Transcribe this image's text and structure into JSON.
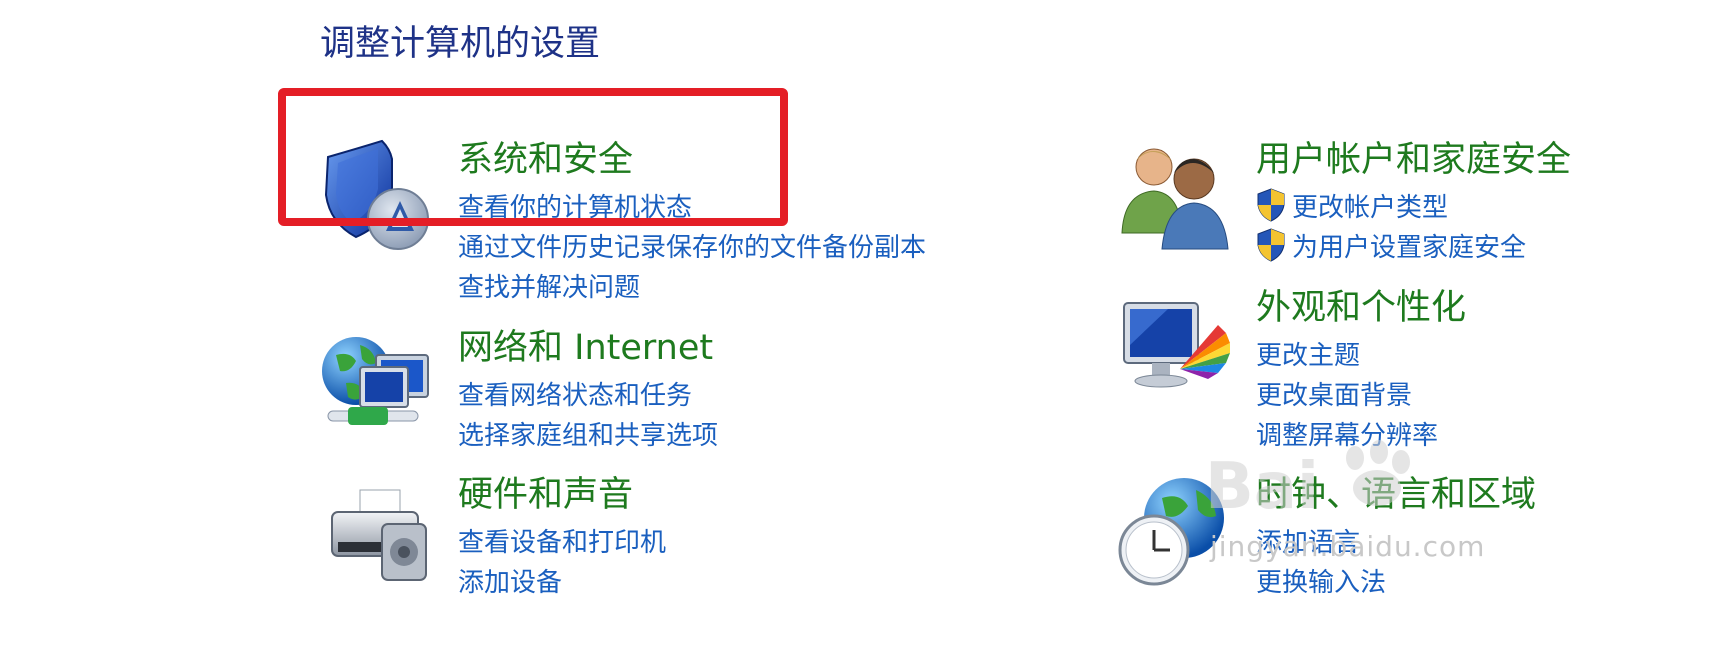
{
  "page_title": "调整计算机的设置",
  "categories": {
    "system": {
      "title": "系统和安全",
      "icon": "shield-icon",
      "links": [
        "查看你的计算机状态",
        "通过文件历史记录保存你的文件备份副本",
        "查找并解决问题"
      ]
    },
    "network": {
      "title": "网络和 Internet",
      "icon": "network-globe-icon",
      "links": [
        "查看网络状态和任务",
        "选择家庭组和共享选项"
      ]
    },
    "hardware": {
      "title": "硬件和声音",
      "icon": "printer-icon",
      "links": [
        "查看设备和打印机",
        "添加设备"
      ]
    },
    "users": {
      "title": "用户帐户和家庭安全",
      "icon": "users-icon",
      "links": [
        "更改帐户类型",
        "为用户设置家庭安全"
      ]
    },
    "appearance": {
      "title": "外观和个性化",
      "icon": "monitor-palette-icon",
      "links": [
        "更改主题",
        "更改桌面背景",
        "调整屏幕分辨率"
      ]
    },
    "clock": {
      "title": "时钟、语言和区域",
      "icon": "clock-globe-icon",
      "links": [
        "添加语言",
        "更换输入法"
      ]
    }
  },
  "watermark": {
    "text": "jingyan.baidu.com",
    "logo_text": "Bai"
  },
  "colors": {
    "title": "#1e3287",
    "category_title": "#1e7a1e",
    "link": "#1a5fbf",
    "highlight": "#e41e26"
  }
}
